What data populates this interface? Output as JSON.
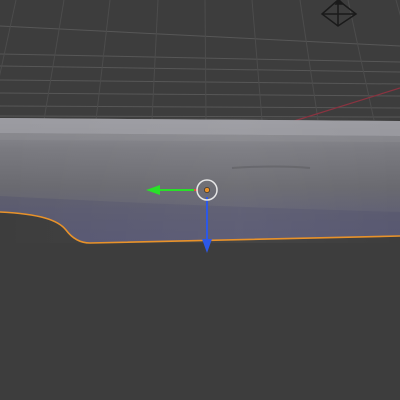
{
  "viewport": {
    "view_mode": "3D viewport",
    "shading": "solid",
    "grid_visible": true,
    "object_selected": true,
    "camera_visible": true,
    "gizmo": {
      "type": "translate",
      "visible_axes": [
        "y",
        "z"
      ]
    }
  },
  "colors": {
    "background": "#3d3d3d",
    "grid_line": "#5a5a5a",
    "grid_line_faint": "#4c4c4c",
    "x_axis": "#8a3340",
    "mesh_top": "#8c8c90",
    "mesh_mid": "#6b6b70",
    "mesh_bottom": "#60607a",
    "selection_outline": "#e8922a",
    "gizmo_y_axis": "#28e028",
    "gizmo_z_axis": "#2c58e8",
    "gizmo_x_axis": "#e84848",
    "origin_dot": "#e8922a",
    "pivot_ring": "#e6e6e6",
    "camera_outline": "#1a1a1a"
  },
  "icons": {
    "camera": "camera-icon",
    "pivot": "pivot-ring-icon",
    "origin": "origin-point-icon"
  }
}
